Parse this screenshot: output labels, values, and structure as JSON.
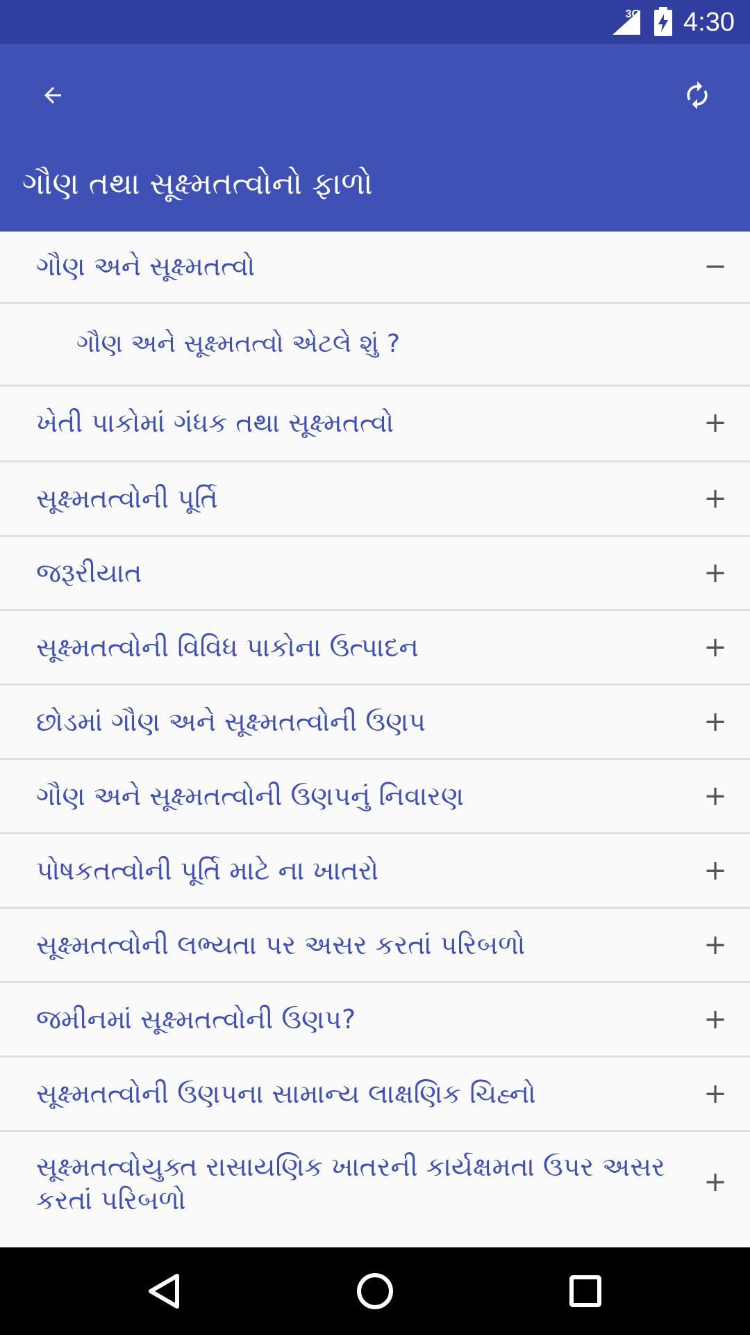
{
  "status_bar": {
    "network": "3G",
    "time": "4:30",
    "icons": [
      "signal-icon",
      "battery-charging-icon"
    ]
  },
  "app_bar": {
    "title": "ગૌણ તથા સૂક્ષ્મતત્વોનો ફાળો",
    "back_icon": "arrow-left-icon",
    "refresh_icon": "refresh-icon"
  },
  "list": {
    "expanded": {
      "label": "ગૌણ અને સૂક્ષ્મતત્વો",
      "toggle": "−",
      "children": [
        "ગૌણ અને સૂક્ષ્મતત્વો એટલે શું ?"
      ]
    },
    "items": [
      {
        "label": "ખેતી પાકોમાં ગંધક તથા સૂક્ષ્મતત્વો",
        "toggle": "+"
      },
      {
        "label": "સૂક્ષ્મતત્વોની પૂર્તિ",
        "toggle": "+"
      },
      {
        "label": "જરૂરીયાત",
        "toggle": "+"
      },
      {
        "label": "સૂક્ષ્મતત્વોની વિવિધ પાકોના ઉત્પાદન",
        "toggle": "+"
      },
      {
        "label": "છોડમાં ગૌણ અને સૂક્ષ્મતત્વોની ઉણપ",
        "toggle": "+"
      },
      {
        "label": "ગૌણ અને સૂક્ષ્મતત્વોની ઉણપનું નિવારણ",
        "toggle": "+"
      },
      {
        "label": "પોષકતત્વોની પૂર્તિ માટે ના ખાતરો",
        "toggle": "+"
      },
      {
        "label": "સૂક્ષ્મતત્વોની લભ્યતા પર અસર કરતાં પરિબળો",
        "toggle": "+"
      },
      {
        "label": "જમીનમાં સૂક્ષ્મતત્વોની ઉણપ?",
        "toggle": "+"
      },
      {
        "label": "સૂક્ષ્મતત્વોની ઉણપના સામાન્ય લાક્ષણિક ચિહ્નો",
        "toggle": "+"
      },
      {
        "label": "સૂક્ષ્મતત્વોયુક્ત રાસાયણિક ખાતરની કાર્યક્ષમતા ઉપર અસર કરતાં પરિબળો",
        "toggle": "+"
      }
    ]
  },
  "nav_bar": {
    "icons": [
      "back-triangle-icon",
      "home-circle-icon",
      "recents-square-icon"
    ]
  },
  "colors": {
    "status_bar": "#303f9f",
    "app_bar": "#3f51b5",
    "item_text": "#3f51b5",
    "divider": "#e0e0e0"
  }
}
